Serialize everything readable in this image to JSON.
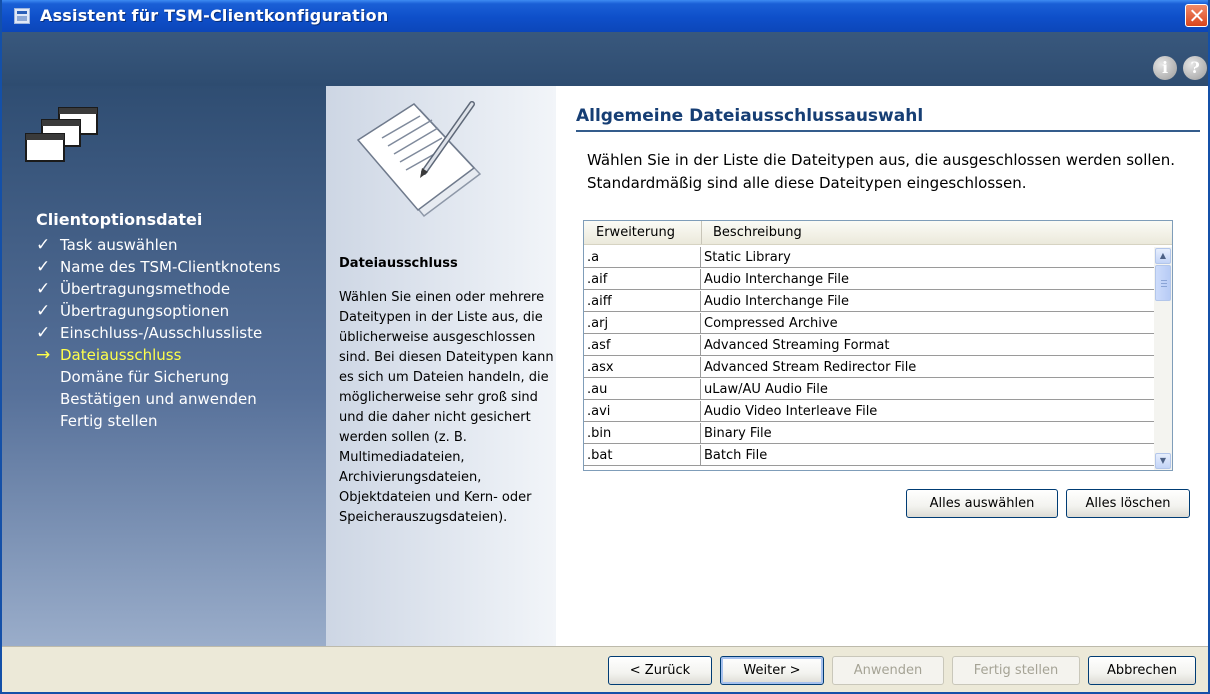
{
  "window": {
    "title": "Assistent für TSM-Clientkonfiguration"
  },
  "sidebar": {
    "section_title": "Clientoptionsdatei",
    "items": [
      {
        "label": "Task auswählen",
        "state": "done"
      },
      {
        "label": "Name des TSM-Clientknotens",
        "state": "done"
      },
      {
        "label": "Übertragungsmethode",
        "state": "done"
      },
      {
        "label": "Übertragungsoptionen",
        "state": "done"
      },
      {
        "label": "Einschluss-/Ausschlussliste",
        "state": "done"
      },
      {
        "label": "Dateiausschluss",
        "state": "current"
      },
      {
        "label": "Domäne für Sicherung",
        "state": "pending"
      },
      {
        "label": "Bestätigen und anwenden",
        "state": "pending"
      },
      {
        "label": "Fertig stellen",
        "state": "pending"
      }
    ],
    "marks": {
      "done": "✓",
      "current": "→",
      "pending": ""
    }
  },
  "info_panel": {
    "title": "Dateiausschluss",
    "description": "Wählen Sie einen oder mehrere Dateitypen in der Liste aus, die üblicherweise ausgeschlossen sind. Bei diesen Dateitypen kann es sich um Dateien handeln, die möglicherweise sehr groß sind und die daher nicht gesichert werden sollen (z. B. Multimediadateien, Archivierungsdateien, Objektdateien und Kern- oder Speicherauszugsdateien)."
  },
  "main": {
    "title": "Allgemeine Dateiausschlussauswahl",
    "intro": "Wählen Sie in der Liste die Dateitypen aus, die ausgeschlossen werden sollen. Standardmäßig sind alle diese Dateitypen eingeschlossen.",
    "table": {
      "columns": [
        "Erweiterung",
        "Beschreibung"
      ],
      "rows": [
        [
          ".a",
          "Static Library"
        ],
        [
          ".aif",
          "Audio Interchange File"
        ],
        [
          ".aiff",
          "Audio Interchange File"
        ],
        [
          ".arj",
          "Compressed Archive"
        ],
        [
          ".asf",
          "Advanced Streaming Format"
        ],
        [
          ".asx",
          "Advanced Stream Redirector File"
        ],
        [
          ".au",
          "uLaw/AU Audio File"
        ],
        [
          ".avi",
          "Audio Video Interleave File"
        ],
        [
          ".bin",
          "Binary File"
        ],
        [
          ".bat",
          "Batch File"
        ]
      ]
    },
    "select_all_label": "Alles auswählen",
    "clear_all_label": "Alles löschen"
  },
  "footer": {
    "back_label": "< Zurück",
    "next_label": "Weiter >",
    "apply_label": "Anwenden",
    "finish_label": "Fertig stellen",
    "cancel_label": "Abbrechen"
  },
  "icons": {
    "app": "wizard-window-icon",
    "close": "close-icon",
    "info": "info-icon",
    "help": "help-icon",
    "sidebar_logo": "stacked-windows-icon",
    "illustration": "paper-pen-icon"
  },
  "colors": {
    "title_bar": "#0e4fc9",
    "header_band": "#2e4c70",
    "current_step": "#ffff4a",
    "section_title": "#163e74"
  }
}
